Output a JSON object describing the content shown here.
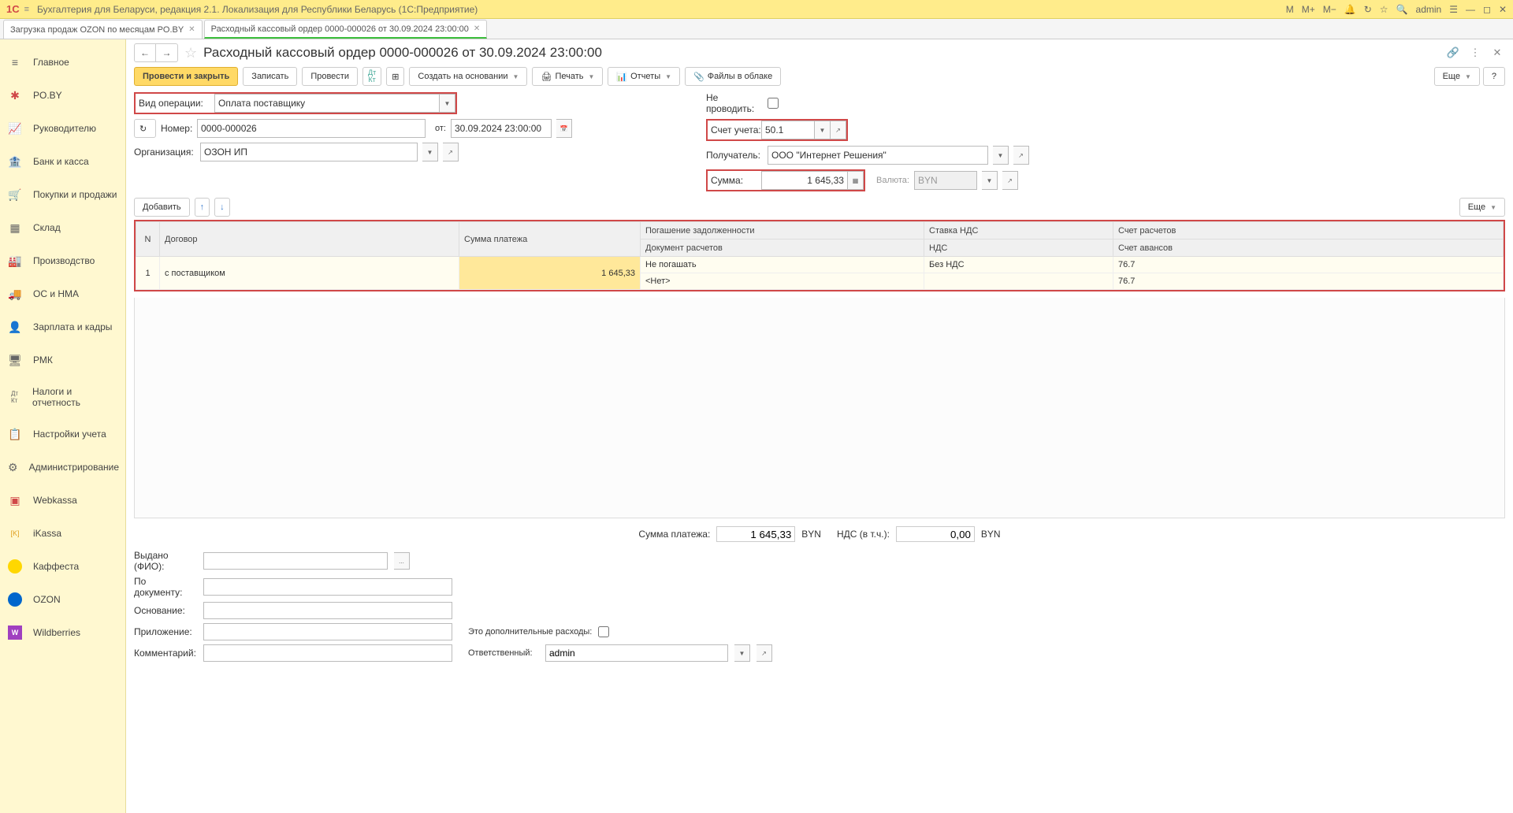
{
  "title": "Бухгалтерия для Беларуси, редакция 2.1. Локализация для Республики Беларусь  (1С:Предприятие)",
  "logo": "1С",
  "topbar_right": {
    "m": "М",
    "m_plus": "М+",
    "m_minus": "М−",
    "user": "admin"
  },
  "tabs": [
    {
      "label": "Загрузка продаж OZON по месяцам PO.BY"
    },
    {
      "label": "Расходный кассовый ордер 0000-000026 от 30.09.2024 23:00:00"
    }
  ],
  "sidebar": [
    {
      "icon": "home",
      "label": "Главное"
    },
    {
      "icon": "poby",
      "label": "PO.BY"
    },
    {
      "icon": "chart",
      "label": "Руководителю"
    },
    {
      "icon": "bank",
      "label": "Банк и касса"
    },
    {
      "icon": "cart",
      "label": "Покупки и продажи"
    },
    {
      "icon": "warehouse",
      "label": "Склад"
    },
    {
      "icon": "factory",
      "label": "Производство"
    },
    {
      "icon": "truck",
      "label": "ОС и НМА"
    },
    {
      "icon": "person",
      "label": "Зарплата и кадры"
    },
    {
      "icon": "pmk",
      "label": "РМК"
    },
    {
      "icon": "tax",
      "label": "Налоги и отчетность"
    },
    {
      "icon": "clipboard",
      "label": "Настройки учета"
    },
    {
      "icon": "gear",
      "label": "Администрирование"
    },
    {
      "icon": "webkassa",
      "label": "Webkassa"
    },
    {
      "icon": "ikassa",
      "label": "iKassa"
    },
    {
      "icon": "kaffesta",
      "label": "Каффеста"
    },
    {
      "icon": "ozon",
      "label": "OZON"
    },
    {
      "icon": "wb",
      "label": "Wildberries"
    }
  ],
  "page": {
    "title": "Расходный кассовый ордер 0000-000026 от 30.09.2024 23:00:00"
  },
  "toolbar": {
    "post_close": "Провести и закрыть",
    "write": "Записать",
    "post": "Провести",
    "create_based": "Создать на основании",
    "print": "Печать",
    "reports": "Отчеты",
    "cloud_files": "Файлы в облаке",
    "more": "Еще",
    "help": "?"
  },
  "form": {
    "op_type_label": "Вид операции:",
    "op_type_value": "Оплата поставщику",
    "number_label": "Номер:",
    "number_value": "0000-000026",
    "from_label": "от:",
    "date_value": "30.09.2024 23:00:00",
    "org_label": "Организация:",
    "org_value": "ОЗОН ИП",
    "skip_post_label": "Не проводить:",
    "account_label": "Счет учета:",
    "account_value": "50.1",
    "recipient_label": "Получатель:",
    "recipient_value": "ООО \"Интернет Решения\"",
    "sum_label": "Сумма:",
    "sum_value": "1 645,33",
    "currency_label": "Валюта:",
    "currency_value": "BYN"
  },
  "table_toolbar": {
    "add": "Добавить",
    "more": "Еще"
  },
  "table": {
    "headers": {
      "n": "N",
      "contract": "Договор",
      "pay_sum": "Сумма платежа",
      "debt_repay": "Погашение задолженности",
      "calc_doc": "Документ расчетов",
      "vat_rate": "Ставка НДС",
      "vat": "НДС",
      "calc_acc": "Счет расчетов",
      "adv_acc": "Счет авансов"
    },
    "rows": [
      {
        "n": "1",
        "contract": "с поставщиком",
        "pay_sum": "1 645,33",
        "debt_repay": "Не погашать",
        "calc_doc": "<Нет>",
        "vat_rate": "Без НДС",
        "vat": "",
        "calc_acc": "76.7",
        "adv_acc": "76.7"
      }
    ]
  },
  "totals": {
    "pay_sum_label": "Сумма платежа:",
    "pay_sum_value": "1 645,33",
    "pay_sum_curr": "BYN",
    "vat_label": "НДС (в т.ч.):",
    "vat_value": "0,00",
    "vat_curr": "BYN"
  },
  "bottom": {
    "issued_label": "Выдано (ФИО):",
    "by_doc_label": "По документу:",
    "basis_label": "Основание:",
    "attachment_label": "Приложение:",
    "extra_expenses_label": "Это дополнительные расходы:",
    "comment_label": "Комментарий:",
    "responsible_label": "Ответственный:",
    "responsible_value": "admin"
  }
}
